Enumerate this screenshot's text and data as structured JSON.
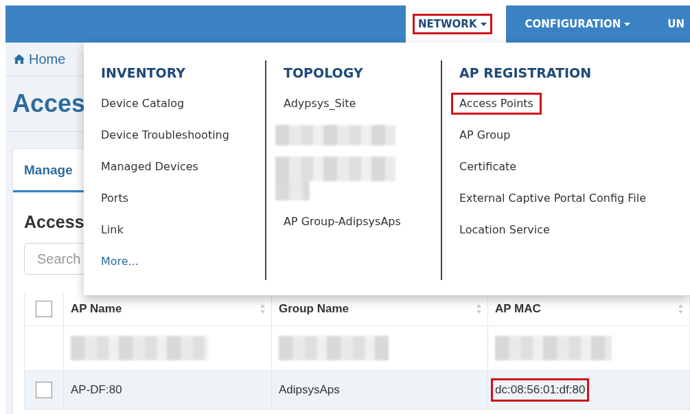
{
  "navbar": {
    "items": [
      {
        "label": "NETWORK",
        "selected": true,
        "highlighted": true
      },
      {
        "label": "CONFIGURATION",
        "selected": false,
        "highlighted": false
      },
      {
        "label": "UN",
        "selected": false,
        "highlighted": false
      }
    ]
  },
  "breadcrumb": {
    "label": "Home"
  },
  "page_title": "Acces",
  "tabs": [
    {
      "label": "Manage",
      "selected": true
    }
  ],
  "section_title": "Access",
  "search": {
    "placeholder": "Search"
  },
  "mega_menu": {
    "columns": [
      {
        "heading": "INVENTORY",
        "items": [
          {
            "kind": "link",
            "label": "Device Catalog",
            "highlighted": false
          },
          {
            "kind": "link",
            "label": "Device Troubleshooting",
            "highlighted": false
          },
          {
            "kind": "link",
            "label": "Managed Devices",
            "highlighted": false
          },
          {
            "kind": "link",
            "label": "Ports",
            "highlighted": false
          },
          {
            "kind": "link",
            "label": "Link",
            "highlighted": false
          },
          {
            "kind": "more",
            "label": "More...",
            "highlighted": false
          }
        ]
      },
      {
        "heading": "TOPOLOGY",
        "items": [
          {
            "kind": "link",
            "label": "Adypsys_Site",
            "highlighted": false
          },
          {
            "kind": "redacted"
          },
          {
            "kind": "redacted-block"
          },
          {
            "kind": "link",
            "label": "AP Group-AdipsysAps",
            "highlighted": false
          }
        ]
      },
      {
        "heading": "AP REGISTRATION",
        "items": [
          {
            "kind": "link",
            "label": "Access Points",
            "highlighted": true
          },
          {
            "kind": "link",
            "label": "AP Group",
            "highlighted": false
          },
          {
            "kind": "link",
            "label": "Certificate",
            "highlighted": false
          },
          {
            "kind": "link",
            "label": "External Captive Portal Config File",
            "highlighted": false
          },
          {
            "kind": "link",
            "label": "Location Service",
            "highlighted": false
          }
        ]
      }
    ]
  },
  "table": {
    "select_all_checked": false,
    "columns": [
      "AP Name",
      "Group Name",
      "AP MAC"
    ],
    "rows": [
      {
        "kind": "redacted"
      },
      {
        "kind": "data",
        "checked": false,
        "cells": [
          {
            "text": "AP-DF:80",
            "highlighted": false
          },
          {
            "text": "AdipsysAps",
            "highlighted": false
          },
          {
            "text": "dc:08:56:01:df:80",
            "highlighted": true
          }
        ]
      }
    ]
  }
}
